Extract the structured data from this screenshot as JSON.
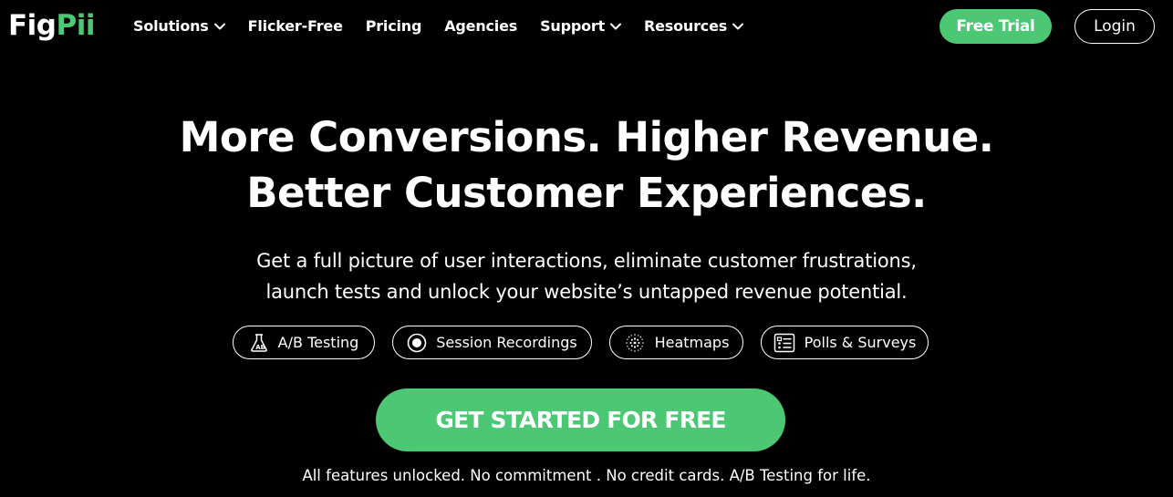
{
  "brand": {
    "logo_part1": "Fig",
    "logo_part2": "Pii",
    "accent_color": "#4cc774"
  },
  "nav": {
    "items": [
      {
        "label": "Solutions",
        "has_dropdown": true
      },
      {
        "label": "Flicker-Free",
        "has_dropdown": false
      },
      {
        "label": "Pricing",
        "has_dropdown": false
      },
      {
        "label": "Agencies",
        "has_dropdown": false
      },
      {
        "label": "Support",
        "has_dropdown": true
      },
      {
        "label": "Resources",
        "has_dropdown": true
      }
    ],
    "free_trial_label": "Free Trial",
    "login_label": "Login"
  },
  "hero": {
    "title_line1": "More Conversions. Higher Revenue.",
    "title_line2": "Better Customer Experiences.",
    "subtitle_line1": "Get a full picture of user interactions, eliminate customer frustrations,",
    "subtitle_line2": "launch tests and unlock your website’s untapped revenue potential.",
    "features": [
      {
        "label": "A/B Testing",
        "icon": "flask-icon"
      },
      {
        "label": "Session Recordings",
        "icon": "record-icon"
      },
      {
        "label": "Heatmaps",
        "icon": "heatmap-icon"
      },
      {
        "label": "Polls & Surveys",
        "icon": "survey-icon"
      }
    ],
    "cta_label": "GET STARTED FOR FREE",
    "footnote": "All features unlocked. No commitment . No credit cards. A/B Testing for life."
  }
}
